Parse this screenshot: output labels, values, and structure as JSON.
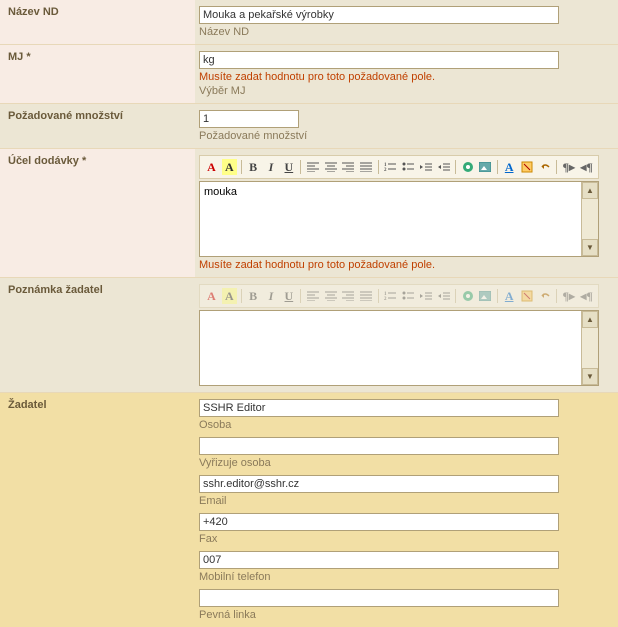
{
  "rows": {
    "nazev_nd": {
      "label": "Název ND",
      "value": "Mouka a pekařské výrobky",
      "hint": "Název ND"
    },
    "mj": {
      "label": "MJ *",
      "value": "kg",
      "error": "Musíte zadat hodnotu pro toto požadované pole.",
      "hint": "Výběr MJ"
    },
    "mnozstvi": {
      "label": "Požadované množství",
      "value": "1",
      "hint": "Požadované množství"
    },
    "ucel": {
      "label": "Účel dodávky *",
      "value": "mouka",
      "error": "Musíte zadat hodnotu pro toto požadované pole."
    },
    "poznamka": {
      "label": "Poznámka žadatel",
      "value": ""
    },
    "zadatel": {
      "label": "Žadatel",
      "osoba": {
        "value": "SSHR Editor",
        "hint": "Osoba"
      },
      "vyrizuje": {
        "value": "",
        "hint": "Vyřizuje osoba"
      },
      "email": {
        "value": "sshr.editor@sshr.cz",
        "hint": "Email"
      },
      "fax": {
        "value": "+420",
        "hint": "Fax"
      },
      "mobil": {
        "value": "007",
        "hint": "Mobilní telefon"
      },
      "pevna": {
        "value": "",
        "hint": "Pevná linka"
      }
    }
  },
  "toolbar": {
    "font_color": "A",
    "highlight": "A",
    "bold": "B",
    "italic": "I",
    "underline": "U"
  }
}
